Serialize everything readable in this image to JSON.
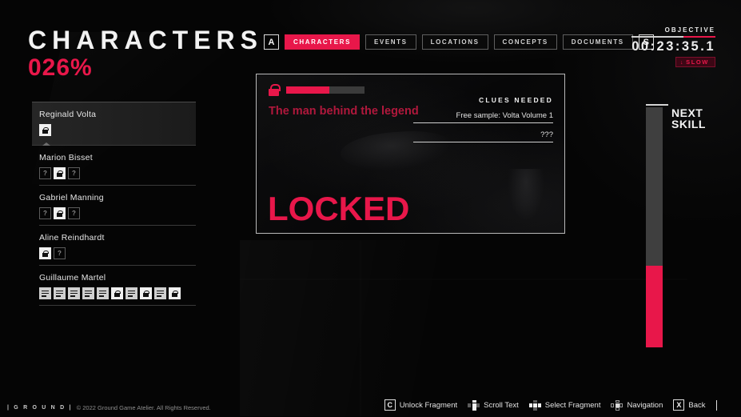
{
  "left": {
    "title": "CHARACTERS",
    "percent": "026%"
  },
  "characters": [
    {
      "name": "Reginald Volta",
      "selected": true,
      "fragments": [
        {
          "type": "lock",
          "label": "locked-fragment"
        }
      ]
    },
    {
      "name": "Marion Bisset",
      "selected": false,
      "fragments": [
        {
          "type": "unknown",
          "label": "?"
        },
        {
          "type": "lock",
          "label": "locked-fragment"
        },
        {
          "type": "unknown",
          "label": "?"
        }
      ]
    },
    {
      "name": "Gabriel Manning",
      "selected": false,
      "fragments": [
        {
          "type": "unknown",
          "label": "?"
        },
        {
          "type": "lock",
          "label": "locked-fragment"
        },
        {
          "type": "unknown",
          "label": "?"
        }
      ]
    },
    {
      "name": "Aline Reindhardt",
      "selected": false,
      "fragments": [
        {
          "type": "lock",
          "label": "locked-fragment"
        },
        {
          "type": "unknown",
          "label": "?"
        }
      ]
    },
    {
      "name": "Guillaume Martel",
      "selected": false,
      "fragments": [
        {
          "type": "text",
          "label": "text-fragment"
        },
        {
          "type": "text",
          "label": "text-fragment"
        },
        {
          "type": "text",
          "label": "text-fragment"
        },
        {
          "type": "text",
          "label": "text-fragment"
        },
        {
          "type": "text",
          "label": "text-fragment"
        },
        {
          "type": "lock",
          "label": "locked-fragment"
        },
        {
          "type": "text",
          "label": "text-fragment"
        },
        {
          "type": "lock",
          "label": "locked-fragment"
        },
        {
          "type": "text",
          "label": "text-fragment"
        },
        {
          "type": "lock",
          "label": "locked-fragment"
        }
      ]
    }
  ],
  "tabs": {
    "prev_key": "A",
    "next_key": "S",
    "items": [
      {
        "label": "CHARACTERS",
        "active": true
      },
      {
        "label": "EVENTS",
        "active": false
      },
      {
        "label": "LOCATIONS",
        "active": false
      },
      {
        "label": "CONCEPTS",
        "active": false
      },
      {
        "label": "DOCUMENTS",
        "active": false
      }
    ]
  },
  "objective": {
    "label": "OBJECTIVE",
    "time": "00:23:35.1",
    "badge": "SLOW",
    "badge_arrow": "↓"
  },
  "card": {
    "title": "The man behind the legend",
    "progress_percent": 55,
    "locked_text": "LOCKED",
    "clues_label": "CLUES NEEDED",
    "clues": [
      "Free sample: Volta Volume 1",
      "???"
    ]
  },
  "skill": {
    "label_line1": "NEXT",
    "label_line2": "SKILL",
    "fill_percent": 34
  },
  "footer": {
    "brand": "| G R O U N D |",
    "copyright": "© 2022 Ground Game Atelier. All Rights Reserved.",
    "hints": [
      {
        "key": "C",
        "type": "key",
        "label": "Unlock Fragment"
      },
      {
        "key": "",
        "type": "dpad-vert",
        "label": "Scroll Text"
      },
      {
        "key": "",
        "type": "dpad-horiz",
        "label": "Select Fragment"
      },
      {
        "key": "",
        "type": "dpad-all",
        "label": "Navigation"
      },
      {
        "key": "X",
        "type": "key",
        "label": "Back"
      }
    ]
  },
  "colors": {
    "accent": "#e8174a",
    "background": "#050505",
    "text": "#f2f2f2"
  }
}
